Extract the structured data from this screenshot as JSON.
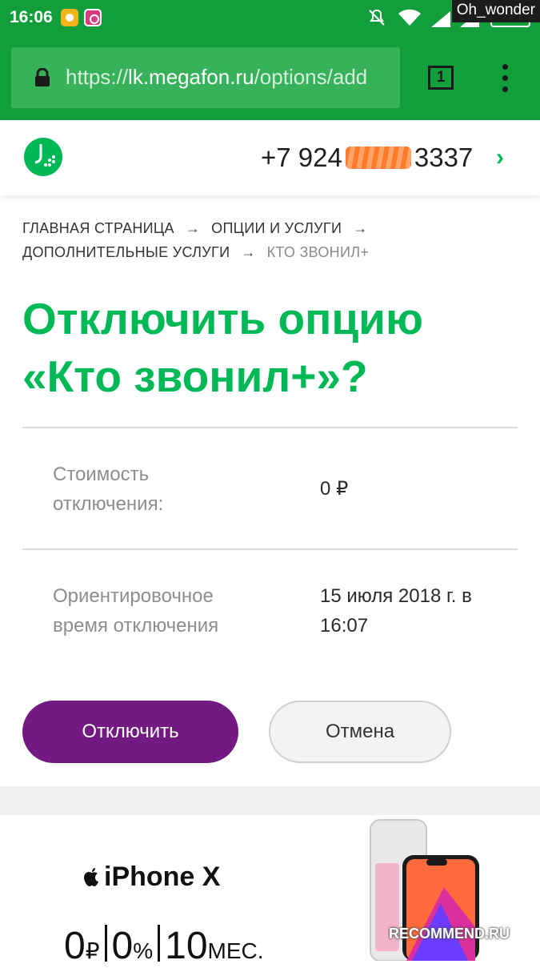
{
  "status_bar": {
    "time": "16:06",
    "watermark": "Oh_wonder"
  },
  "browser": {
    "url_prefix": "https://",
    "url_domain": "lk.megafon.ru",
    "url_path": "/options/add",
    "tab_count": "1"
  },
  "header": {
    "phone_start": "+7 924",
    "phone_end": "3337"
  },
  "breadcrumb": {
    "items": [
      "ГЛАВНАЯ СТРАНИЦА",
      "ОПЦИИ И УСЛУГИ",
      "ДОПОЛНИТЕЛЬНЫЕ УСЛУГИ"
    ],
    "current": "КТО ЗВОНИЛ+",
    "separator": "→"
  },
  "title": {
    "line1": "Отключить опцию",
    "line2": "«Кто звонил+»?"
  },
  "details": [
    {
      "label": "Стоимость отключения:",
      "value": "0 ₽"
    },
    {
      "label": "Ориентировочное время отключения",
      "value": "15 июля 2018 г. в 16:07"
    }
  ],
  "actions": {
    "confirm_label": "Отключить",
    "cancel_label": "Отмена"
  },
  "promo": {
    "brand": "iPhone X",
    "term1": "0",
    "term1_unit": "₽",
    "term2": "0",
    "term2_unit": "%",
    "term3": "10",
    "term3_unit": "МЕС."
  },
  "watermark_bottom": "RECOMMEND.RU",
  "colors": {
    "brand_green": "#00b956",
    "browser_green": "#119e3b",
    "primary_purple": "#731982"
  }
}
